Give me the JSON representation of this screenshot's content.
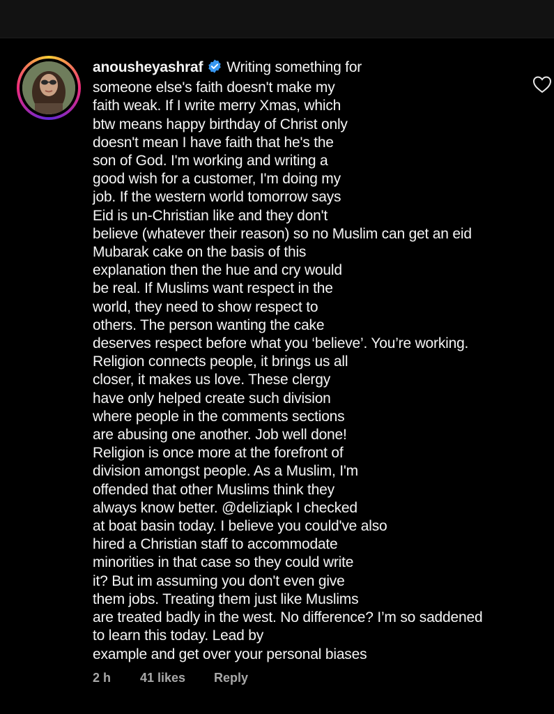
{
  "comment": {
    "username": "anousheyashraf",
    "verified": true,
    "text": "Writing something for\nsomeone else's faith doesn't make my\nfaith weak. If I write merry Xmas, which\nbtw means happy birthday of Christ only\ndoesn't mean I have faith that he's the\nson of God. I'm working and writing a\ngood wish for a customer, I'm doing my\njob. If the western world tomorrow says\nEid is un-Christian like and they don't\nbelieve (whatever their reason) so no Muslim can get an eid\nMubarak cake on the basis of this\nexplanation then the hue and cry would\nbe real. If Muslims want respect in the\nworld, they need to show respect to\nothers. The person wanting the cake\ndeserves respect before what you ‘believe’. You’re working.\nReligion connects people, it brings us all\ncloser, it makes us love. These clergy\nhave only helped create such division\nwhere people in the comments sections\nare abusing one another. Job well done!\nReligion is once more at the forefront of\ndivision amongst people. As a Muslim, I'm\noffended that other Muslims think they\nalways know better. @deliziapk I checked\nat boat basin today. I believe you could've also\nhired a Christian staff to accommodate\nminorities in that case so they could write\nit? But im assuming you don't even give\nthem jobs. Treating them just like Muslims\nare treated badly in the west. No difference? I’m so saddened\nto learn this today. Lead by\nexample and get over your personal biases",
    "time": "2 h",
    "likes": "41 likes",
    "reply_label": "Reply"
  },
  "icons": {
    "avatar": "profile-photo",
    "verified": "verified-badge-icon",
    "like": "heart-outline-icon"
  },
  "colors": {
    "background": "#000000",
    "text": "#f5f5f5",
    "meta": "#a8a8a8",
    "verified": "#3897f0"
  }
}
